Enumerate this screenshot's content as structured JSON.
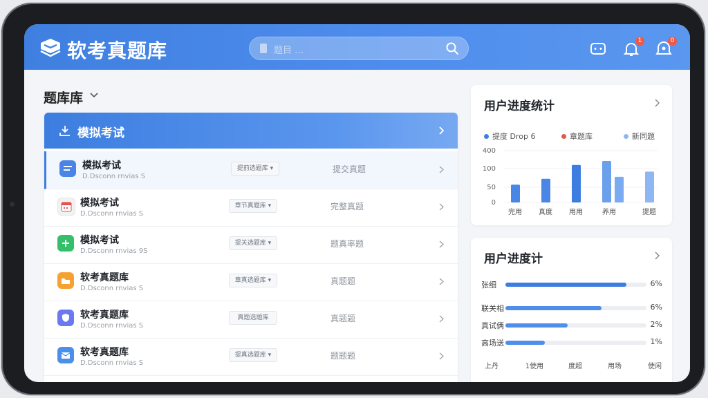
{
  "header": {
    "app_title": "软考真题库",
    "search_placeholder": "题目 …",
    "notification_count": "1",
    "profile_badge": "0"
  },
  "library": {
    "title": "题库库",
    "featured": {
      "label": "模拟考试"
    },
    "rows": [
      {
        "title": "模拟考试",
        "subtitle": "D.Dsconn rnvias S",
        "tag": "提前选题库 ▾",
        "status": "提交真题",
        "icon": "doc-icon",
        "color": "#4a84e6"
      },
      {
        "title": "模拟考试",
        "subtitle": "D.Dsconn rnvias S",
        "tag": "章节真题库 ▾",
        "status": "完整真题",
        "icon": "calendar-icon",
        "color": "#f2f2f2"
      },
      {
        "title": "模拟考试",
        "subtitle": "D.Dsconn rnvias 9S",
        "tag": "提关选题库 ▾",
        "status": "题真率题",
        "icon": "plus-icon",
        "color": "#34c06a"
      },
      {
        "title": "软考真题库",
        "subtitle": "D.Dsconn rnvias S",
        "tag": "章真选题库 ▾",
        "status": "真题题",
        "icon": "folder-icon",
        "color": "#f6a233"
      },
      {
        "title": "软考真题库",
        "subtitle": "D.Dsconn rnvias S",
        "tag": "真题选题库",
        "status": "真题题",
        "icon": "shield-icon",
        "color": "#6a79f0"
      },
      {
        "title": "软考真题库",
        "subtitle": "D.Dsconn rnvias S",
        "tag": "提真选题库 ▾",
        "status": "题题题",
        "icon": "mail-icon",
        "color": "#4a8fea"
      }
    ]
  },
  "stats_panel": {
    "title": "用户进度统计",
    "legend": [
      {
        "label": "提度 Drop 6",
        "color": "#3f7fe0"
      },
      {
        "label": "章题库",
        "color": "#e5574a"
      },
      {
        "label": "新同题",
        "color": "#8eb6f2"
      }
    ]
  },
  "chart_data": {
    "type": "bar",
    "categories": [
      "完用",
      "真度",
      "用用",
      "养用",
      "提题"
    ],
    "yticks": [
      "400",
      "100",
      "50",
      "0"
    ],
    "series": [
      {
        "values": [
          {
            "x": "完用",
            "v": 45,
            "color": "#4a86e6"
          },
          {
            "x": "真度",
            "v": 60,
            "color": "#4a86e6"
          },
          {
            "x": "用用",
            "v": 95,
            "color": "#3c7ddf"
          },
          {
            "x": "养用",
            "v": 105,
            "color": "#6aa0ec"
          },
          {
            "x": "养用",
            "v": 65,
            "color": "#7aaaf0"
          },
          {
            "x": "提题",
            "v": 78,
            "color": "#8eb6f2"
          }
        ]
      }
    ],
    "ylim": [
      0,
      140
    ],
    "grid": true
  },
  "progress_panel": {
    "title": "用户进度计",
    "items": [
      {
        "label": "张细",
        "value": "6%",
        "fraction": 0.86
      },
      {
        "label": "联关相",
        "value": "6%",
        "fraction": 0.68
      },
      {
        "label": "真试俩",
        "value": "2%",
        "fraction": 0.44
      },
      {
        "label": "高场送",
        "value": "1%",
        "fraction": 0.28
      }
    ],
    "xlabels": [
      "上丹",
      "1使用",
      "度超",
      "用场",
      "使闲"
    ]
  }
}
